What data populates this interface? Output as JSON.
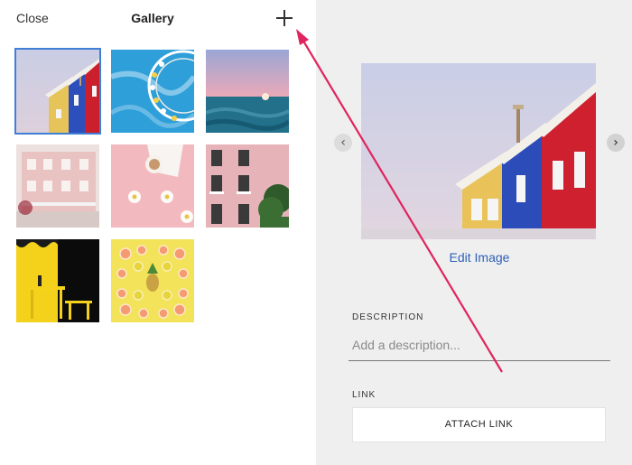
{
  "header": {
    "close_label": "Close",
    "title": "Gallery",
    "add_icon": "plus-icon"
  },
  "gallery": {
    "items": [
      {
        "subject": "colorful-houses",
        "selected": true
      },
      {
        "subject": "ferris-wheel",
        "selected": false
      },
      {
        "subject": "ocean-sunset",
        "selected": false
      },
      {
        "subject": "pink-building",
        "selected": false
      },
      {
        "subject": "coffee-flowers",
        "selected": false
      },
      {
        "subject": "pink-facade",
        "selected": false
      },
      {
        "subject": "yellow-chair",
        "selected": false
      },
      {
        "subject": "citrus-fruits",
        "selected": false
      }
    ]
  },
  "details": {
    "prev_icon": "chevron-left-icon",
    "next_icon": "chevron-right-icon",
    "edit_image_label": "Edit Image",
    "description_label": "DESCRIPTION",
    "description_placeholder": "Add a description...",
    "description_value": "",
    "link_label": "LINK",
    "attach_link_label": "ATTACH LINK"
  },
  "colors": {
    "accent": "#2c5fb7",
    "selection": "#3f7fd6",
    "annotation_arrow": "#e0245e",
    "panel_bg": "#efefef"
  }
}
